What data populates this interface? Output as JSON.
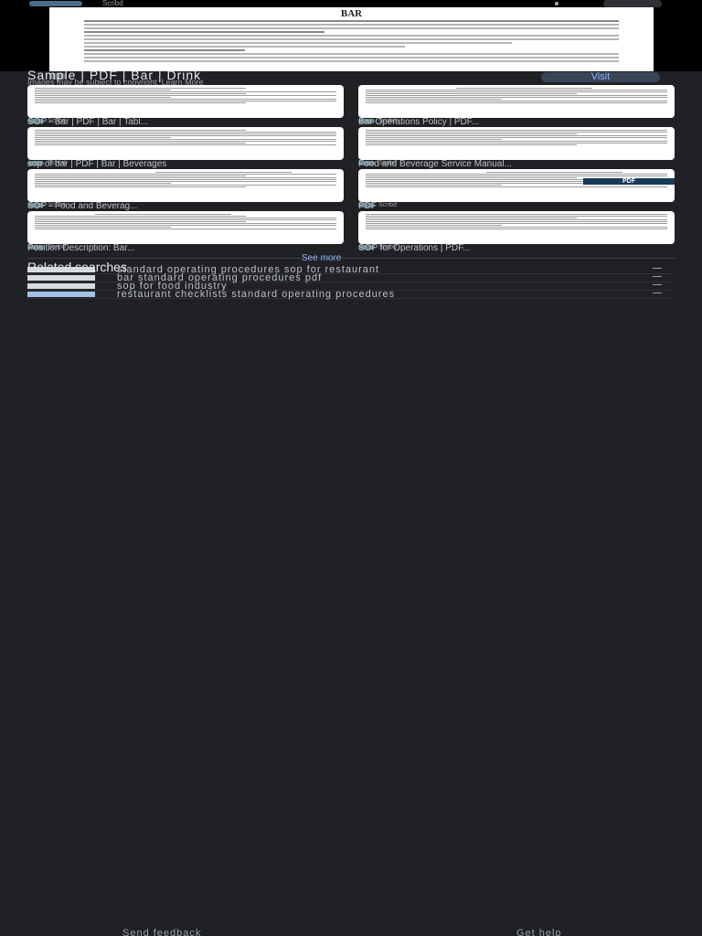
{
  "top_bar": {
    "source_name": "Scribd"
  },
  "preview": {
    "doc_title": "BAR"
  },
  "result": {
    "title": "Sample | PDF | Bar | Drink",
    "visit_label": "Visit",
    "copyright_note": "Images may be subject to copyright. Learn More"
  },
  "grid": {
    "items": [
      {
        "source": "Scribd",
        "caption": "SOP - Bar | PDF | Bar | Tabl..."
      },
      {
        "source": "Scribd",
        "caption": "Bar Operations Policy | PDF..."
      },
      {
        "source": "Scribd",
        "caption": "sop of bar | PDF | Bar | Beverages"
      },
      {
        "source": "Scribd",
        "caption": "Food and Beverage Service Manual..."
      },
      {
        "source": "Scribd",
        "caption": "SOP - Food and Beverag..."
      },
      {
        "source": "Scribd",
        "caption": "PDF",
        "badge": "PDF"
      },
      {
        "source": "Scribd",
        "caption": "Position Description: Bar..."
      },
      {
        "source": "Scribd",
        "caption": "SOP for Operations | PDF..."
      }
    ]
  },
  "see_more": "See more",
  "related": {
    "heading": "Related searches",
    "items": [
      {
        "text": "standard operating procedures sop for restaurant"
      },
      {
        "text": "bar standard operating procedures pdf"
      },
      {
        "text": "sop for food industry"
      },
      {
        "text": "restaurant checklists standard operating procedures"
      }
    ]
  },
  "footer": {
    "feedback": "Send feedback",
    "help": "Get help"
  }
}
